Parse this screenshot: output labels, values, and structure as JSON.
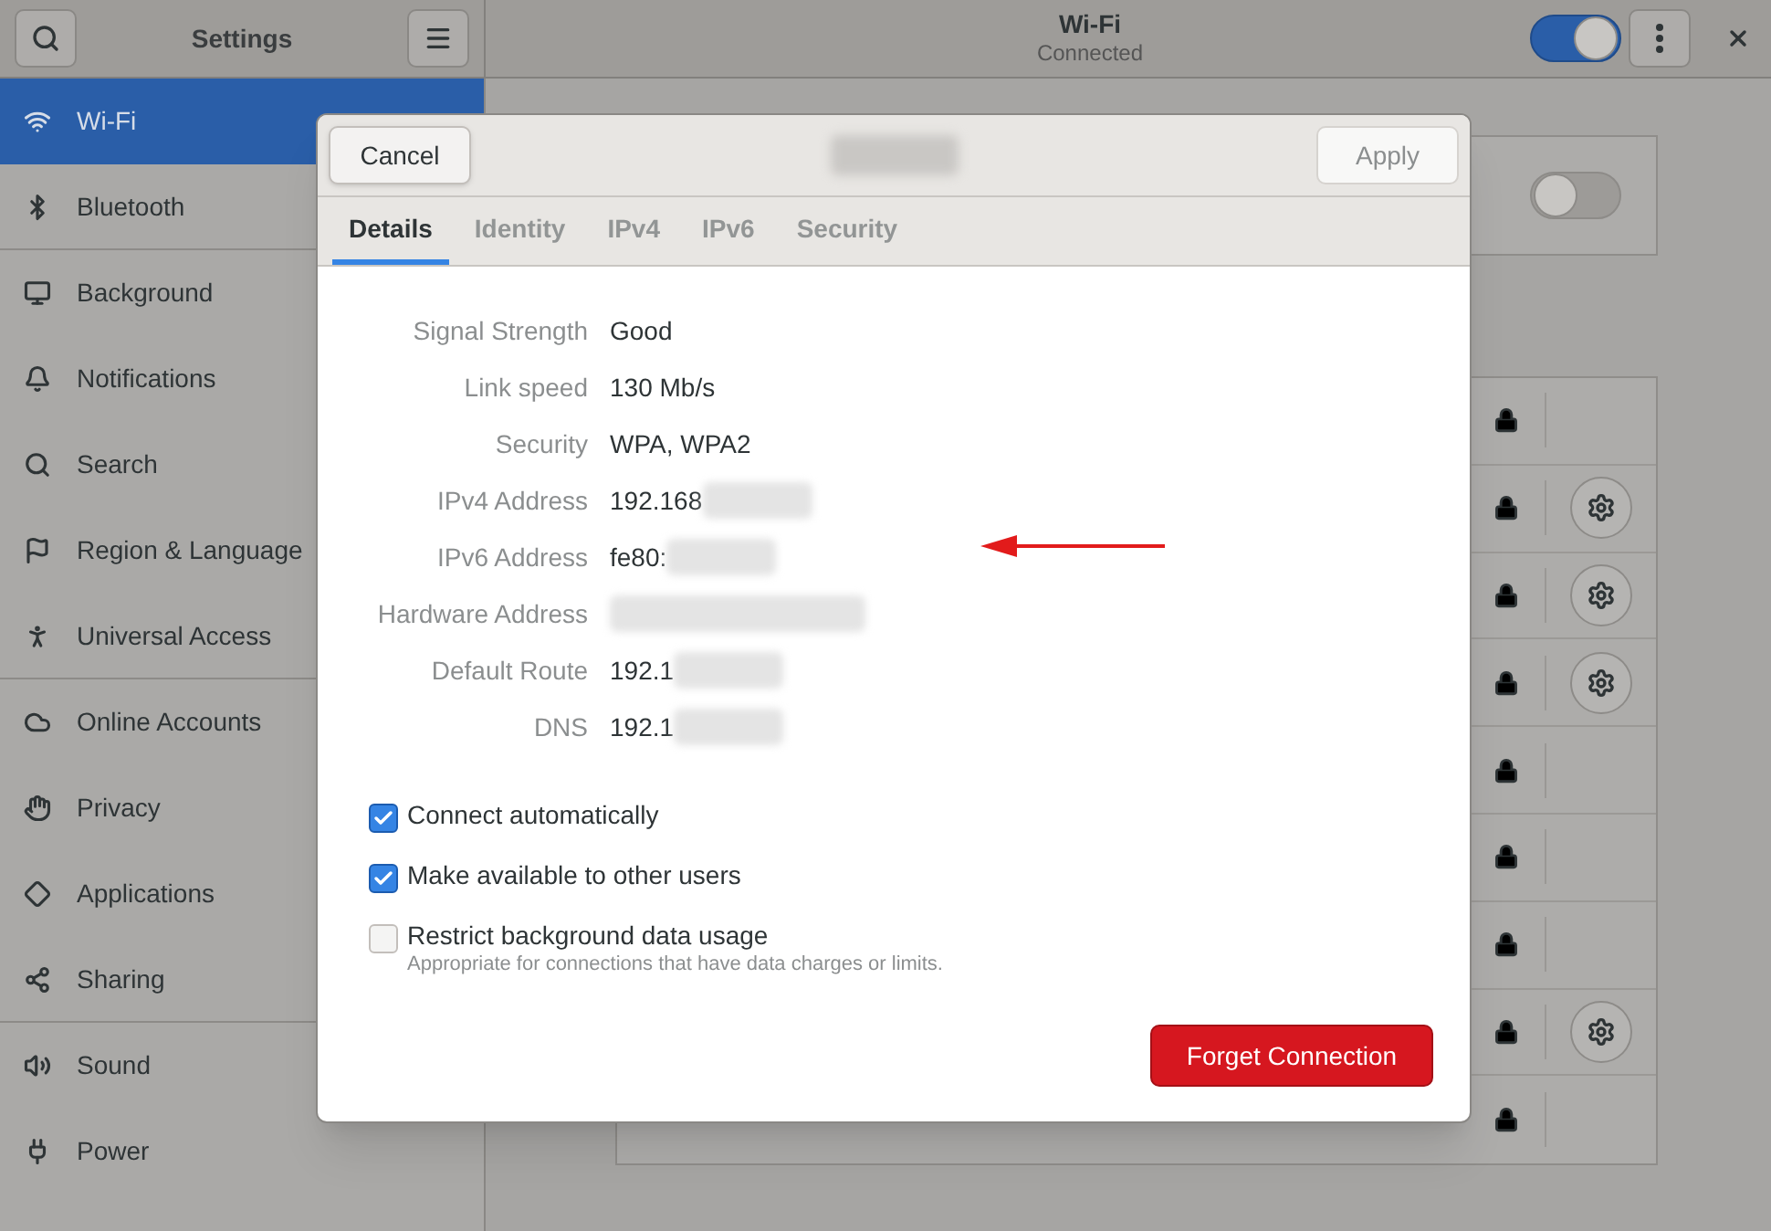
{
  "header": {
    "sidebar_title": "Settings",
    "title": "Wi-Fi",
    "subtitle": "Connected",
    "wifi_on": true
  },
  "sidebar": {
    "items": [
      {
        "label": "Wi-Fi",
        "selected": true,
        "separator_after": false
      },
      {
        "label": "Bluetooth",
        "selected": false,
        "separator_after": true
      },
      {
        "label": "Background",
        "selected": false,
        "separator_after": false
      },
      {
        "label": "Notifications",
        "selected": false,
        "separator_after": false
      },
      {
        "label": "Search",
        "selected": false,
        "separator_after": false
      },
      {
        "label": "Region & Language",
        "selected": false,
        "separator_after": false
      },
      {
        "label": "Universal Access",
        "selected": false,
        "separator_after": true
      },
      {
        "label": "Online Accounts",
        "selected": false,
        "separator_after": false
      },
      {
        "label": "Privacy",
        "selected": false,
        "separator_after": false
      },
      {
        "label": "Applications",
        "selected": false,
        "separator_after": false
      },
      {
        "label": "Sharing",
        "selected": false,
        "separator_after": true
      },
      {
        "label": "Sound",
        "selected": false,
        "separator_after": false
      },
      {
        "label": "Power",
        "selected": false,
        "separator_after": false
      }
    ]
  },
  "airplane_mode": {
    "on": false
  },
  "networks": [
    {
      "kind": "plain"
    },
    {
      "kind": "configured"
    },
    {
      "kind": "configured"
    },
    {
      "kind": "configured"
    },
    {
      "kind": "plain"
    },
    {
      "kind": "plain"
    },
    {
      "kind": "plain"
    },
    {
      "kind": "configured"
    },
    {
      "kind": "plain"
    }
  ],
  "dialog": {
    "cancel": "Cancel",
    "title_blurred": true,
    "apply": {
      "label": "Apply",
      "disabled": true
    },
    "tabs": [
      {
        "label": "Details",
        "selected": true
      },
      {
        "label": "Identity",
        "selected": false
      },
      {
        "label": "IPv4",
        "selected": false
      },
      {
        "label": "IPv6",
        "selected": false
      },
      {
        "label": "Security",
        "selected": false
      }
    ],
    "details": [
      {
        "label": "Signal Strength",
        "value": "Good",
        "blurred": false
      },
      {
        "label": "Link speed",
        "value": "130 Mb/s",
        "blurred": false
      },
      {
        "label": "Security",
        "value": "WPA, WPA2",
        "blurred": false
      },
      {
        "label": "IPv4 Address",
        "value": "192.168",
        "blurred": true
      },
      {
        "label": "IPv6 Address",
        "value": "fe80:",
        "blurred": true
      },
      {
        "label": "Hardware Address",
        "blurred": true
      },
      {
        "label": "Default Route",
        "value": "192.1",
        "blurred": true
      },
      {
        "label": "DNS",
        "value": "192.1",
        "blurred": true
      }
    ],
    "options": [
      {
        "label": "Connect automatically",
        "checked": true
      },
      {
        "label": "Make available to other users",
        "checked": true
      },
      {
        "label": "Restrict background data usage",
        "hint": "Appropriate for connections that have data charges or limits.",
        "checked": false
      }
    ],
    "forget": "Forget Connection"
  }
}
